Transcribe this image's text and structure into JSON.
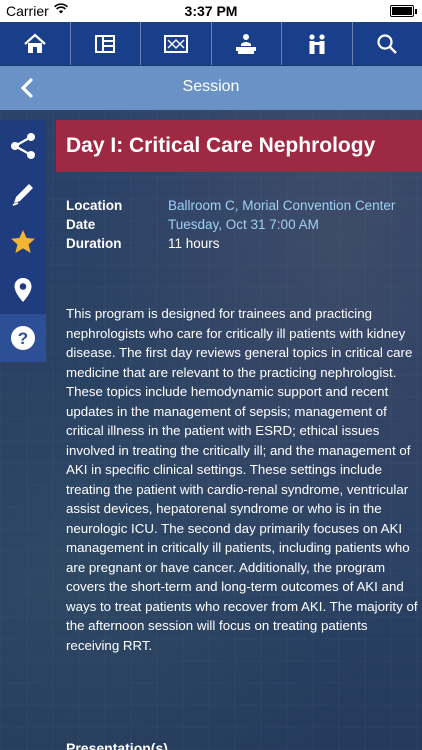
{
  "status_bar": {
    "carrier": "Carrier",
    "time": "3:37 PM",
    "battery_level": 1.0
  },
  "top_nav": {
    "items": [
      {
        "name": "home-icon"
      },
      {
        "name": "schedule-icon"
      },
      {
        "name": "map-icon"
      },
      {
        "name": "exhibitor-icon"
      },
      {
        "name": "attendees-icon"
      },
      {
        "name": "search-icon"
      }
    ],
    "background": "#1a3f8a"
  },
  "header": {
    "title": "Session",
    "background": "#6a92c6"
  },
  "action_bar": {
    "items": [
      "share-icon",
      "edit-note-icon",
      "favorite-star-icon",
      "location-pin-icon",
      "help-icon"
    ]
  },
  "session": {
    "title": "Day I: Critical Care Nephrology",
    "banner_color": "#9e2943",
    "location_label": "Location",
    "location_value": "Ballroom C, Morial Convention Center",
    "date_label": "Date",
    "date_value": "Tuesday, Oct 31 7:00 AM",
    "duration_label": "Duration",
    "duration_value": "11 hours",
    "description": "This program is designed for trainees and practicing nephrologists who care for critically ill patients with kidney disease. The first day reviews general topics in critical care medicine that are relevant to the practicing nephrologist. These topics include hemodynamic support and recent updates in the management of sepsis; management of critical illness in the patient with ESRD; ethical issues involved in treating the critically ill; and the management of AKI in specific clinical settings. These settings include treating the patient with cardio-renal syndrome, ventricular assist devices, hepatorenal syndrome or who is in the neurologic ICU. The second day primarily focuses on AKI management in critically ill patients, including patients who are pregnant or have cancer. Additionally, the program covers the short-term and long-term outcomes of AKI and ways to treat patients who recover from AKI. The majority of the afternoon session will focus on treating patients receiving RRT.",
    "presentations_heading": "Presentation(s)"
  },
  "colors": {
    "link": "#9fd0f5",
    "accent_star": "#f2b531"
  }
}
